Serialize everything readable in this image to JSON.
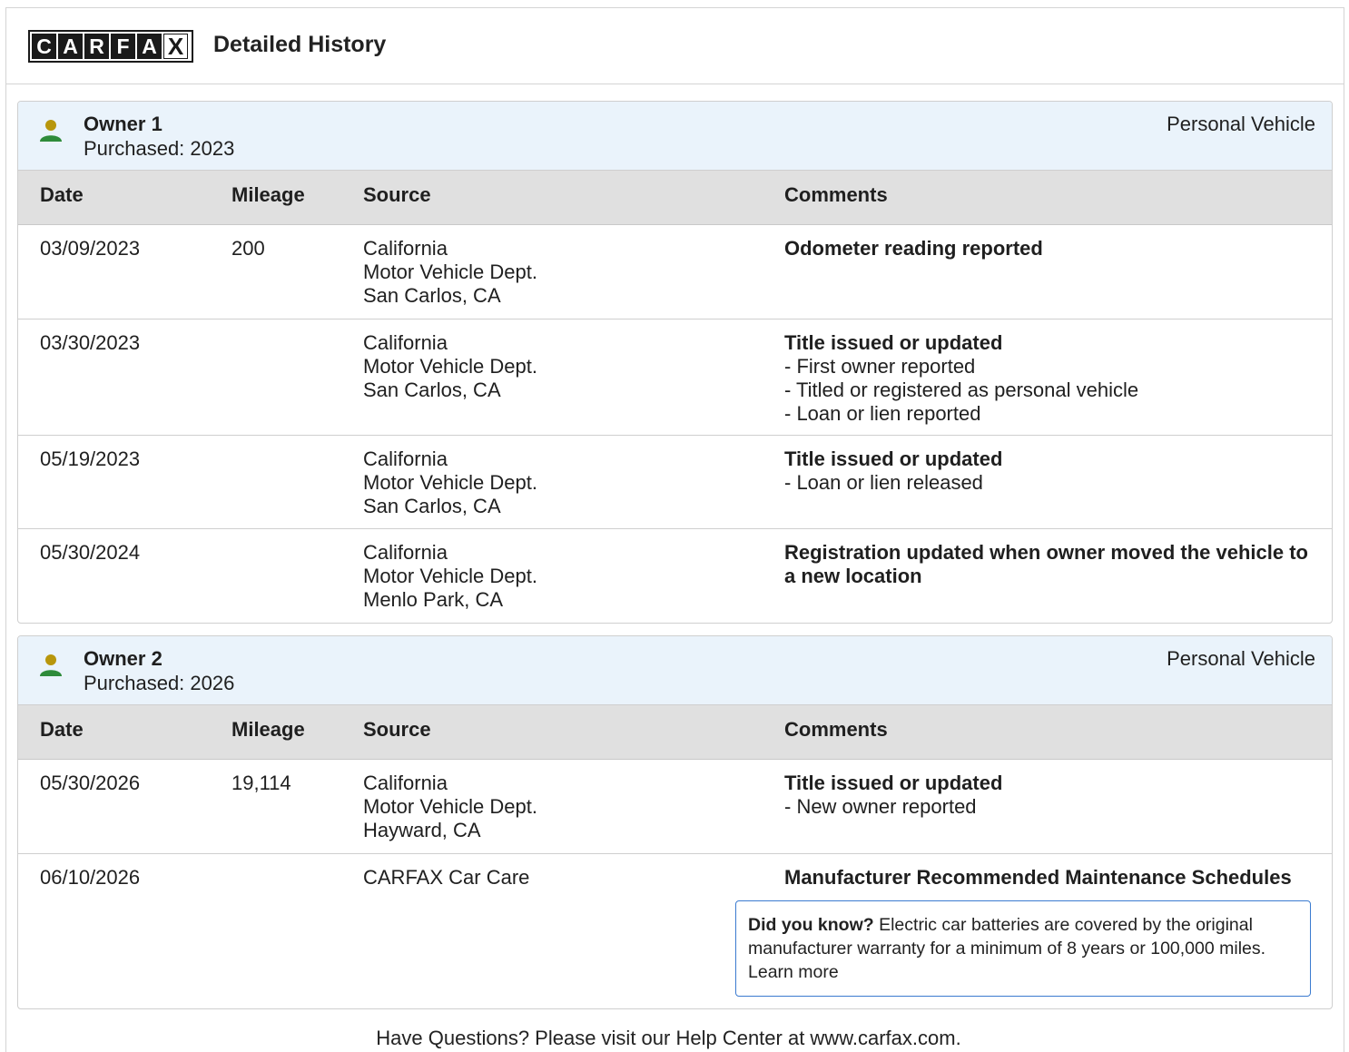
{
  "header": {
    "logo_letters": [
      "C",
      "A",
      "R",
      "F",
      "A",
      "X"
    ],
    "title": "Detailed History"
  },
  "columns": {
    "date": "Date",
    "mileage": "Mileage",
    "source": "Source",
    "comments": "Comments"
  },
  "owners": [
    {
      "name": "Owner 1",
      "purchased": "Purchased: 2023",
      "type": "Personal Vehicle",
      "rows": [
        {
          "date": "03/09/2023",
          "mileage": "200",
          "source": [
            "California",
            "Motor Vehicle Dept.",
            "San Carlos, CA"
          ],
          "comment_title": "Odometer reading reported",
          "comment_items": []
        },
        {
          "date": "03/30/2023",
          "mileage": "",
          "source": [
            "California",
            "Motor Vehicle Dept.",
            "San Carlos, CA"
          ],
          "comment_title": "Title issued or updated",
          "comment_items": [
            "- First owner reported",
            "- Titled or registered as personal vehicle",
            "- Loan or lien reported"
          ]
        },
        {
          "date": "05/19/2023",
          "mileage": "",
          "source": [
            "California",
            "Motor Vehicle Dept.",
            "San Carlos, CA"
          ],
          "comment_title": "Title issued or updated",
          "comment_items": [
            "- Loan or lien released"
          ]
        },
        {
          "date": "05/30/2024",
          "mileage": "",
          "source": [
            "California",
            "Motor Vehicle Dept.",
            "Menlo Park, CA"
          ],
          "comment_title": "Registration updated when owner moved the vehicle to a new location",
          "comment_items": []
        }
      ]
    },
    {
      "name": "Owner 2",
      "purchased": "Purchased: 2026",
      "type": "Personal Vehicle",
      "rows": [
        {
          "date": "05/30/2026",
          "mileage": "19,114",
          "source": [
            "California",
            "Motor Vehicle Dept.",
            "Hayward, CA"
          ],
          "comment_title": "Title issued or updated",
          "comment_items": [
            "- New owner reported"
          ]
        },
        {
          "date": "06/10/2026",
          "mileage": "",
          "source": [
            "CARFAX Car Care"
          ],
          "comment_title": "Manufacturer Recommended Maintenance Schedules",
          "comment_items": []
        }
      ]
    }
  ],
  "tip": {
    "lead": "Did you know?",
    "body": " Electric car batteries are covered by the original manufacturer warranty for a minimum of 8 years or 100,000 miles.",
    "link": "Learn more"
  },
  "footer": {
    "text": "Have Questions? Please visit our Help Center at www.carfax.com."
  },
  "colors": {
    "owner_head_bg": "#eaf3fb",
    "table_head_bg": "#e0e0e0",
    "owner_icon_head": "#b8960c",
    "owner_icon_body": "#2e8b3a",
    "tip_border": "#3b7bd0"
  }
}
